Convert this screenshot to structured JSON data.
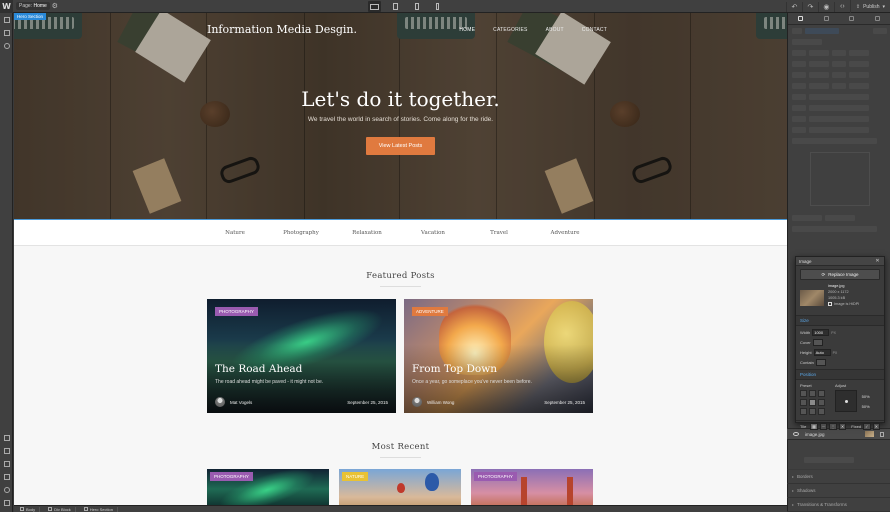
{
  "toolbar": {
    "logo": "W",
    "page_label": "Page:",
    "page_name": "Home",
    "publish": "Publish",
    "devices": [
      "desktop",
      "tablet",
      "mobile-landscape",
      "mobile-portrait"
    ]
  },
  "selection_label": "Hero Section",
  "site": {
    "brand": "Information Media Desgin.",
    "nav": [
      "HOME",
      "CATEGORIES",
      "ABOUT",
      "CONTACT"
    ],
    "hero_title": "Let's do it together.",
    "hero_subtitle": "We travel the world in search of stories. Come along for the ride.",
    "hero_button": "View Latest Posts",
    "categories": [
      "Nature",
      "Photography",
      "Relaxation",
      "Vacation",
      "Travel",
      "Adventure"
    ],
    "featured_heading": "Featured Posts",
    "featured": [
      {
        "tag": "PHOTOGRAPHY",
        "title": "The Road Ahead",
        "excerpt": "The road ahead might be paved - it might not be.",
        "author": "Mat Vogels",
        "date": "September 25, 2015"
      },
      {
        "tag": "ADVENTURE",
        "title": "From Top Down",
        "excerpt": "Once a year, go someplace you've never been before.",
        "author": "William Wong",
        "date": "September 25, 2015"
      }
    ],
    "recent_heading": "Most Recent",
    "recent": [
      {
        "tag": "PHOTOGRAPHY"
      },
      {
        "tag": "NATURE"
      },
      {
        "tag": "PHOTOGRAPHY"
      }
    ]
  },
  "breadcrumbs": [
    "Body",
    "Div Block",
    "Hero Section"
  ],
  "image_panel": {
    "title": "Image",
    "replace_button": "Replace Image",
    "file_name": "image.jpg",
    "dimensions": "2000 x 1172",
    "file_size": "1005.3 kB",
    "hidpi_label": "Image is HiDPI",
    "size_section": "Size",
    "width_label": "Width",
    "width_value": "1000",
    "width_unit": "PX",
    "cover_label": "Cover",
    "height_label": "Height",
    "height_value": "Auto",
    "height_unit": "PX",
    "contain_label": "Contain",
    "position_section": "Position",
    "preset_label": "Preset",
    "adjust_label": "Adjust",
    "adjust_x": "50%",
    "adjust_y": "50%",
    "tile_label": "Tile",
    "fixed_label": "Fixed"
  },
  "background_item": "image.jpg",
  "panel_sections": [
    "Borders",
    "Shadows",
    "Transitions & Transforms"
  ]
}
